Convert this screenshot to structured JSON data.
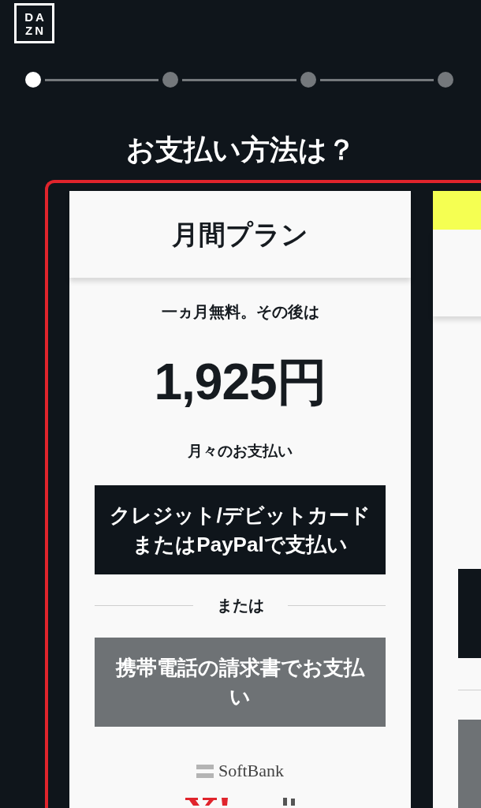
{
  "logo": {
    "lines": [
      "DA",
      "ZN"
    ]
  },
  "steps": [
    {
      "selected": true
    },
    {
      "selected": false
    },
    {
      "selected": false
    },
    {
      "selected": false
    }
  ],
  "title": "お支払い方法は？",
  "plans": [
    {
      "ribbon": false,
      "name": "月間プラン",
      "offer": "一ヵ月無料。その後は",
      "price": "1,925円",
      "billing": "月々のお支払い",
      "buttons": [
        {
          "kind": "primary",
          "label": "クレジット/デビットカードまたはPayPalで支払い"
        },
        {
          "kind": "secondary",
          "label": "携帯電話の請求書でお支払い"
        }
      ],
      "separator": "または",
      "carriers": [
        {
          "kind": "softbank",
          "name": "SoftBank"
        },
        {
          "kind": "ymobile"
        }
      ]
    },
    {
      "ribbon": true,
      "buttons": [
        {
          "kind": "primary"
        },
        {
          "kind": "secondary"
        }
      ]
    }
  ]
}
